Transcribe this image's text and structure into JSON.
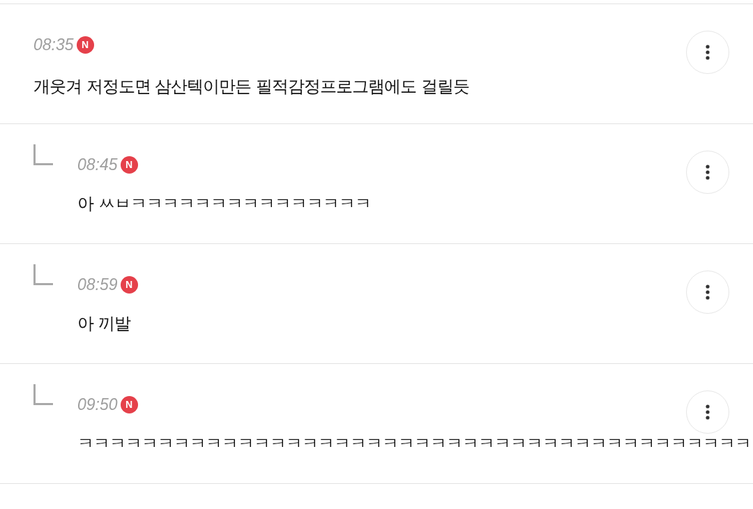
{
  "comments": [
    {
      "kind": "comment",
      "time": "08:35",
      "badge": "N",
      "text": "개웃겨 저정도면 삼산텍이만든 필적감정프로그램에도 걸릴듯"
    },
    {
      "kind": "reply",
      "time": "08:45",
      "badge": "N",
      "text": "아 ㅆㅂㅋㅋㅋㅋㅋㅋㅋㅋㅋㅋㅋㅋㅋㅋㅋ"
    },
    {
      "kind": "reply",
      "time": "08:59",
      "badge": "N",
      "text": "아 끼발"
    },
    {
      "kind": "reply",
      "time": "09:50",
      "badge": "N",
      "text": "ㅋㅋㅋㅋㅋㅋㅋㅋㅋㅋㅋㅋㅋㅋㅋㅋㅋㅋㅋㅋㅋㅋㅋㅋㅋㅋㅋㅋㅋㅋㅋㅋㅋㅋㅋㅋㅋㅋㅋㅋㅋㅋ"
    }
  ]
}
